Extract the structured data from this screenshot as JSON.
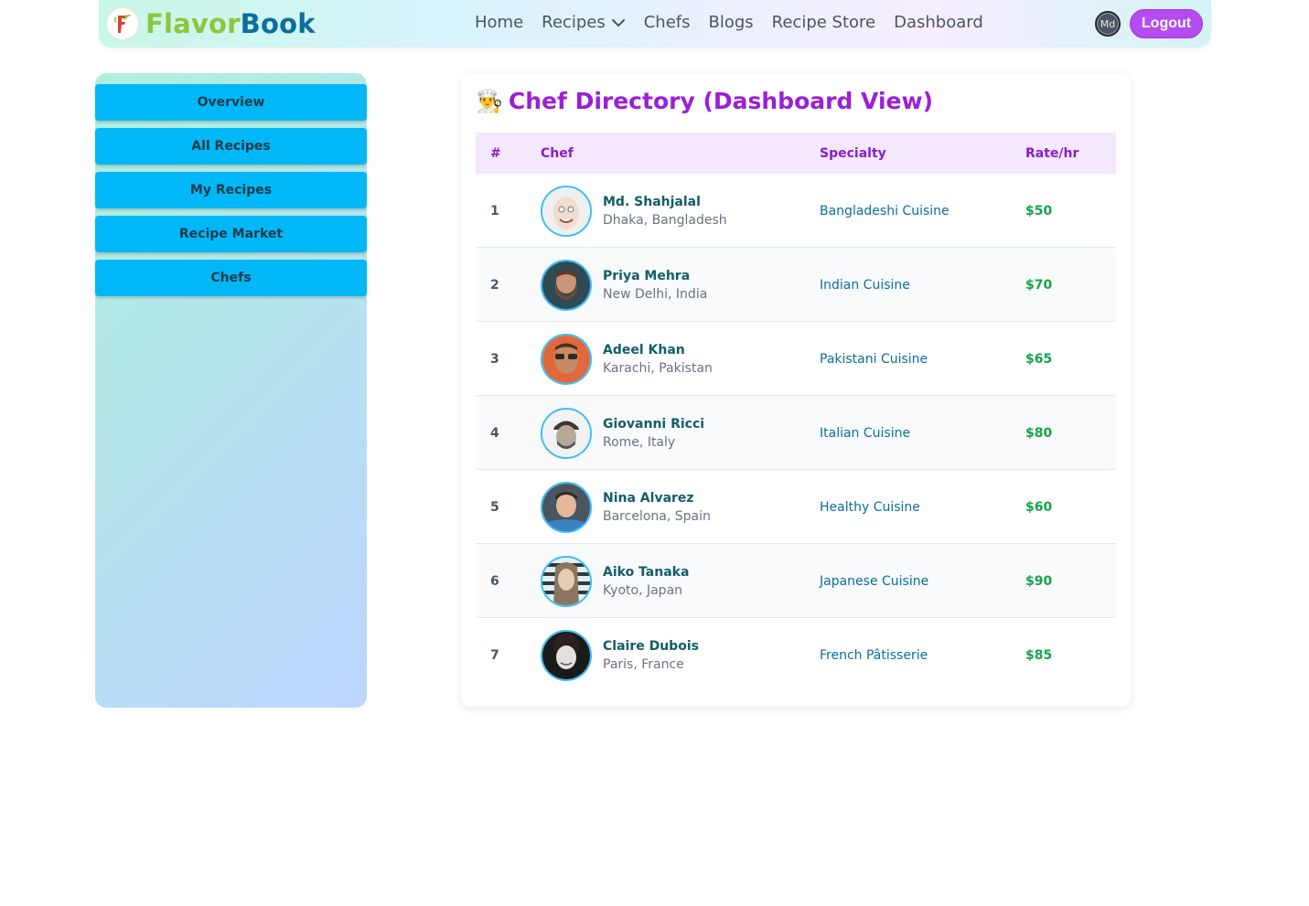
{
  "brand": {
    "part1": "Flavor",
    "part2": "Book"
  },
  "nav": {
    "home": "Home",
    "recipes": "Recipes",
    "chefs": "Chefs",
    "blogs": "Blogs",
    "recipe_store": "Recipe Store",
    "dashboard": "Dashboard"
  },
  "user": {
    "initials": "Md",
    "logout": "Logout"
  },
  "sidebar": {
    "items": [
      {
        "label": "Overview"
      },
      {
        "label": "All Recipes"
      },
      {
        "label": "My Recipes"
      },
      {
        "label": "Recipe Market"
      },
      {
        "label": "Chefs"
      }
    ]
  },
  "main": {
    "emoji": "👨‍🍳",
    "title": "Chef Directory (Dashboard View)",
    "columns": {
      "num": "#",
      "chef": "Chef",
      "specialty": "Specialty",
      "rate": "Rate/hr"
    },
    "chefs": [
      {
        "num": "1",
        "name": "Md. Shahjalal",
        "location": "Dhaka, Bangladesh",
        "specialty": "Bangladeshi Cuisine",
        "rate": "$50",
        "avatar": "photo-bald-smiling-man"
      },
      {
        "num": "2",
        "name": "Priya Mehra",
        "location": "New Delhi, India",
        "specialty": "Indian Cuisine",
        "rate": "$70",
        "avatar": "photo-bearded-man"
      },
      {
        "num": "3",
        "name": "Adeel Khan",
        "location": "Karachi, Pakistan",
        "specialty": "Pakistani Cuisine",
        "rate": "$65",
        "avatar": "photo-man-sunglasses"
      },
      {
        "num": "4",
        "name": "Giovanni Ricci",
        "location": "Rome, Italy",
        "specialty": "Italian Cuisine",
        "rate": "$80",
        "avatar": "photo-man-cap"
      },
      {
        "num": "5",
        "name": "Nina Alvarez",
        "location": "Barcelona, Spain",
        "specialty": "Healthy Cuisine",
        "rate": "$60",
        "avatar": "photo-man-blue-shirt"
      },
      {
        "num": "6",
        "name": "Aiko Tanaka",
        "location": "Kyoto, Japan",
        "specialty": "Japanese Cuisine",
        "rate": "$90",
        "avatar": "photo-woman-long-hair"
      },
      {
        "num": "7",
        "name": "Claire Dubois",
        "location": "Paris, France",
        "specialty": "French Pâtisserie",
        "rate": "$85",
        "avatar": "photo-curly-hair-man"
      }
    ]
  },
  "colors": {
    "accent": "#9b1fd6",
    "sidebar_button": "#00b8f7",
    "logout": "#b44cf0",
    "rate_green": "#16a34a",
    "specialty_blue": "#0b6e9e"
  }
}
